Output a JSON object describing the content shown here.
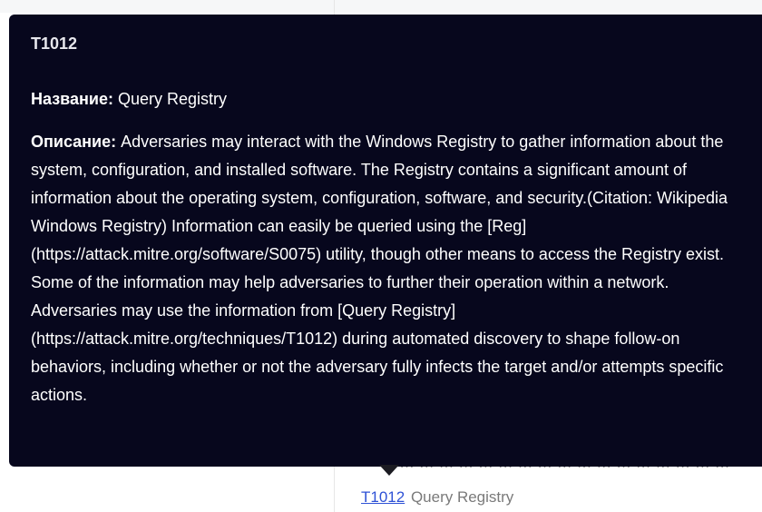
{
  "tooltip": {
    "id": "T1012",
    "name_label": "Название:",
    "name_value": "Query Registry",
    "desc_label": "Описание:",
    "desc_value": "Adversaries may interact with the Windows Registry to gather information about the system, configuration, and installed software. The Registry contains a significant amount of information about the operating system, configuration, software, and security.(Citation: Wikipedia Windows Registry) Information can easily be queried using the [Reg](https://attack.mitre.org/software/S0075) utility, though other means to access the Registry exist. Some of the information may help adversaries to further their operation within a network. Adversaries may use the information from [Query Registry](https://attack.mitre.org/techniques/T1012) during automated discovery to shape follow-on behaviors, including whether or not the adversary fully infects the target and/or attempts specific actions."
  },
  "background": {
    "row_partial": "… … … … … … … … … … … … … … … … …",
    "link_text": "T1012",
    "link_label": "Query Registry"
  }
}
